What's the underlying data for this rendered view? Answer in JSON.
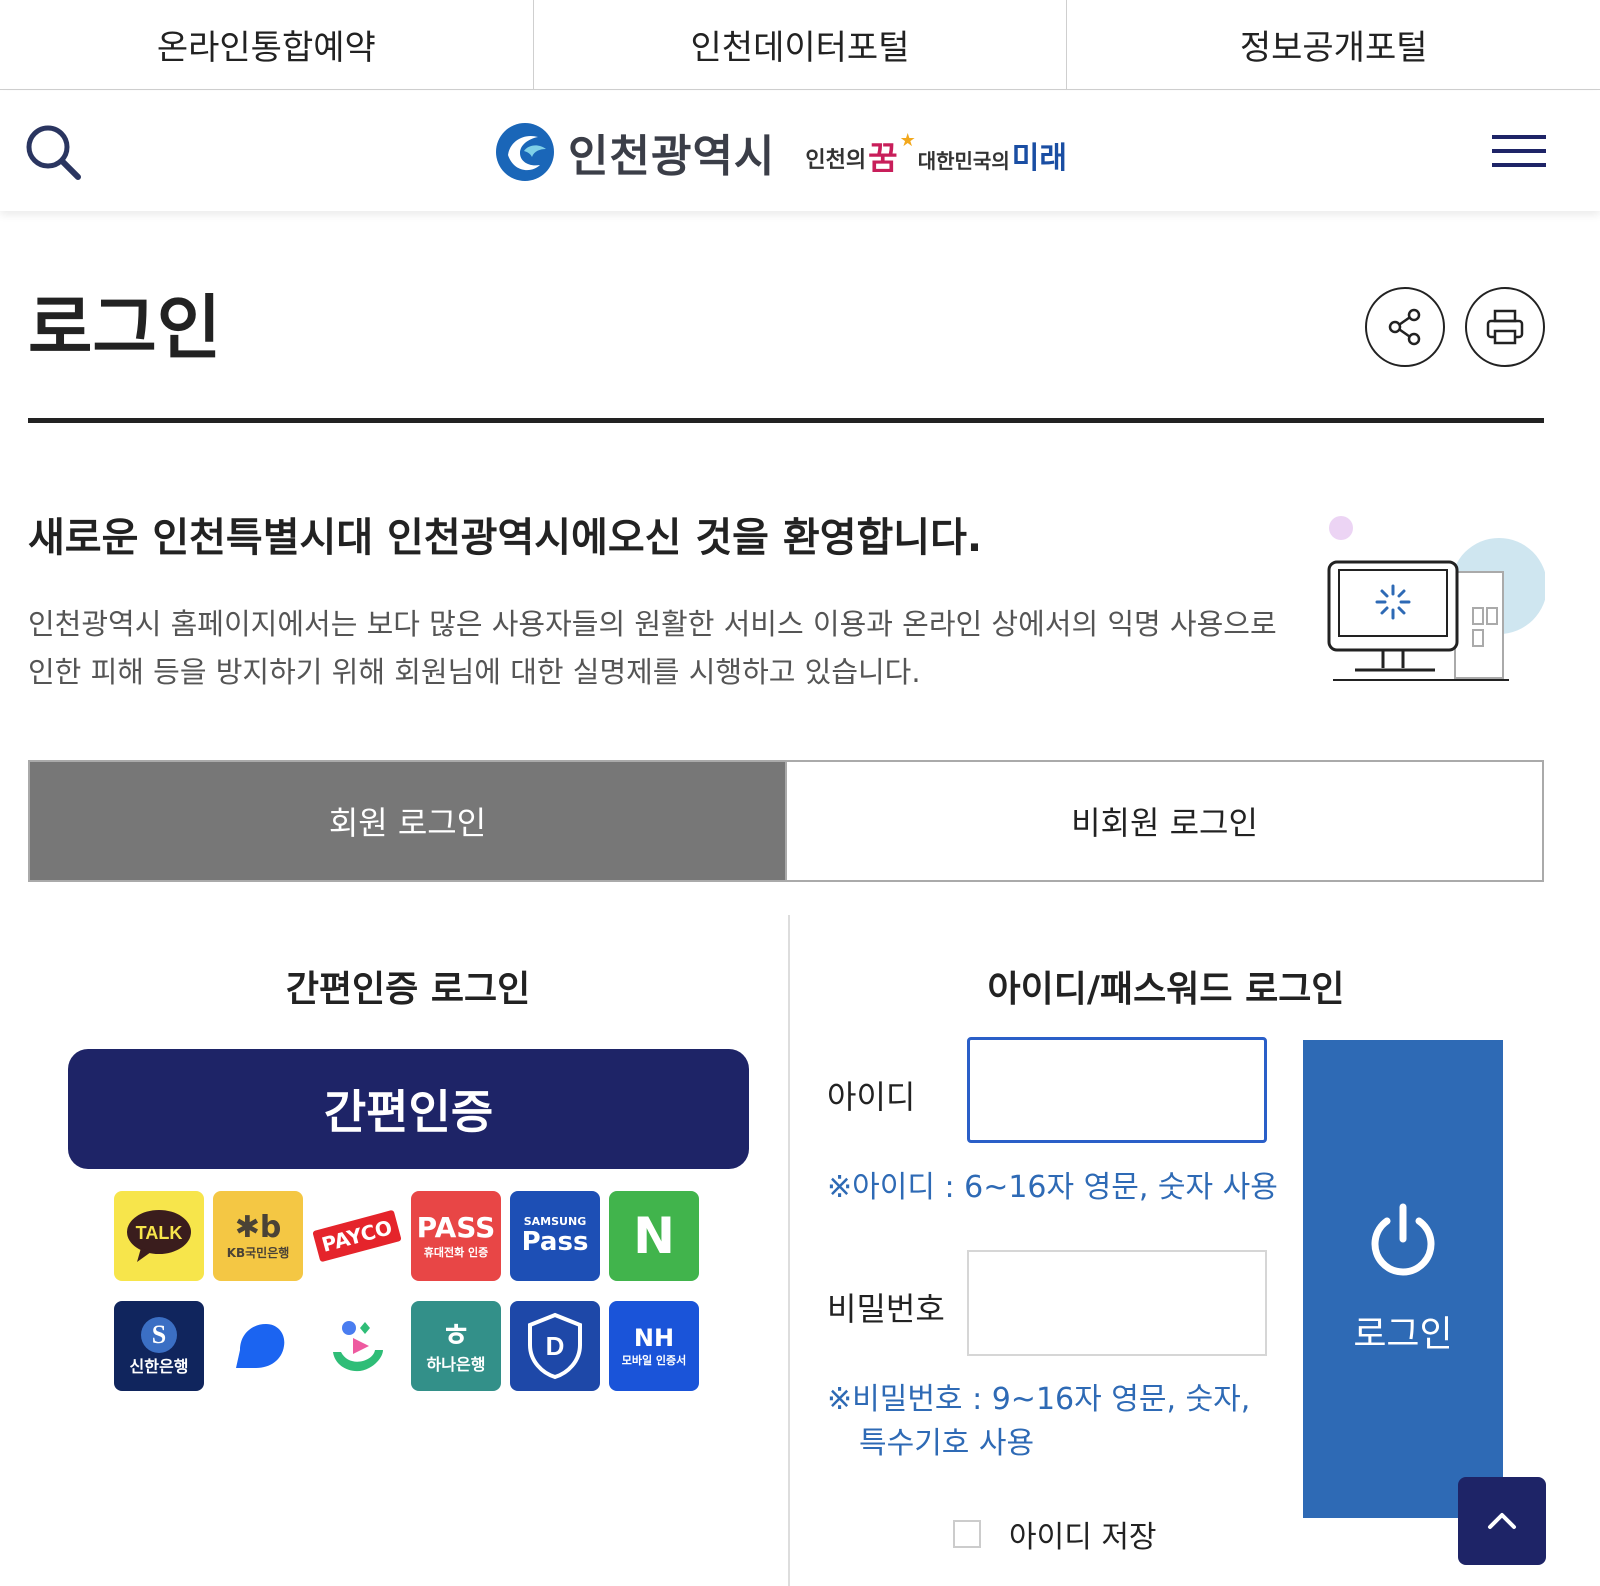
{
  "portal_bar": {
    "links": [
      "온라인통합예약",
      "인천데이터포털",
      "정보공개포털"
    ]
  },
  "header": {
    "logo_text": "인천광역시",
    "slogan": {
      "part1": "인천의",
      "part2": "꿈",
      "part3": "대한민국의",
      "part4": "미래"
    },
    "icons": {
      "search": "search-icon",
      "menu": "hamburger-menu-icon"
    }
  },
  "page": {
    "title": "로그인",
    "actions": {
      "share": "share-icon",
      "print": "print-icon"
    }
  },
  "welcome": {
    "title": "새로운 인천특별시대 인천광역시에오신 것을 환영합니다.",
    "line1": "인천광역시 홈페이지에서는 보다 많은 사용자들의 원활한 서비스 이용과 온라인 상에서의 익명 사용으로",
    "line2": "인한 피해 등을 방지하기 위해 회원님에 대한 실명제를 시행하고 있습니다."
  },
  "tabs": [
    {
      "label": "회원 로그인",
      "active": true
    },
    {
      "label": "비회원 로그인",
      "active": false
    }
  ],
  "easy_login": {
    "heading": "간편인증 로그인",
    "button_label": "간편인증",
    "providers": [
      {
        "name": "kakaotalk",
        "text": "TALK",
        "sub": "",
        "bg": "#f7e54b",
        "fg": "#3a1d1d"
      },
      {
        "name": "kb-kookmin",
        "text": "★b",
        "sub": "KB국민은행",
        "bg": "#f4c744",
        "fg": "#4a4236"
      },
      {
        "name": "payco",
        "text": "PAYCO",
        "sub": "",
        "bg": "#ffffff",
        "fg": "#e5242b"
      },
      {
        "name": "pass",
        "text": "PASS",
        "sub": "휴대전화 인증",
        "bg": "#e84646",
        "fg": "#ffffff"
      },
      {
        "name": "samsung-pass",
        "text": "Pass",
        "sub": "SAMSUNG",
        "bg": "#1d4fb5",
        "fg": "#ffffff"
      },
      {
        "name": "naver",
        "text": "N",
        "sub": "",
        "bg": "#41b44c",
        "fg": "#ffffff"
      },
      {
        "name": "shinhan",
        "text": "S",
        "sub": "신한은행",
        "bg": "#10255d",
        "fg": "#ffffff"
      },
      {
        "name": "toss",
        "text": "",
        "sub": "",
        "bg": "#ffffff",
        "fg": "#1b64f1"
      },
      {
        "name": "banksalad",
        "text": "",
        "sub": "",
        "bg": "#ffffff",
        "fg": "#2fbd77"
      },
      {
        "name": "hana",
        "text": "ㅎ",
        "sub": "하나은행",
        "bg": "#339089",
        "fg": "#ffffff"
      },
      {
        "name": "dream-security",
        "text": "D",
        "sub": "",
        "bg": "#1e48a8",
        "fg": "#ffffff"
      },
      {
        "name": "nh",
        "text": "NH",
        "sub": "모바일 인증서",
        "bg": "#1a54d9",
        "fg": "#ffffff"
      }
    ]
  },
  "idpw_login": {
    "heading": "아이디/패스워드 로그인",
    "id_label": "아이디",
    "id_value": "",
    "id_hint": "※아이디 : 6~16자 영문, 숫자 사용",
    "pw_label": "비밀번호",
    "pw_value": "",
    "pw_hint_line1": "※비밀번호 : 9~16자 영문, 숫자,",
    "pw_hint_line2": "특수기호 사용",
    "login_button": "로그인",
    "login_icon": "power-icon",
    "save_id_label": "아이디 저장",
    "save_id_checked": false
  },
  "scroll_top_icon": "chevron-up-icon",
  "colors": {
    "navy": "#1e2467",
    "blue": "#2e6ab5",
    "tab_active": "#777777"
  }
}
